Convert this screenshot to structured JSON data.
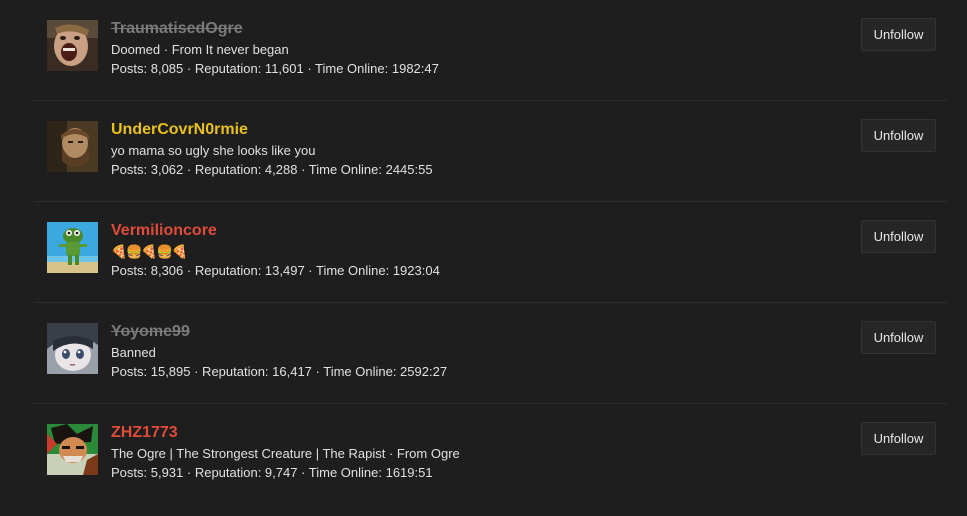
{
  "follow_list": {
    "unfollow_label": "Unfollow",
    "users": [
      {
        "username": "TraumatisedOgre",
        "status": "banned",
        "tagline": "Doomed · From It never began",
        "stats": "Posts: 8,085 · Reputation: 11,601 · Time Online: 1982:47",
        "avatar_icon": "screaming-face-photo"
      },
      {
        "username": "UnderCovrN0rmie",
        "status": "yellow",
        "tagline": "yo mama so ugly she looks like you",
        "stats": "Posts: 3,062 · Reputation: 4,288 · Time Online: 2445:55",
        "avatar_icon": "bearded-man-photo"
      },
      {
        "username": "Vermilioncore",
        "status": "red",
        "tagline": "🍕🍔🍕🍔🍕",
        "stats": "Posts: 8,306 · Reputation: 13,497 · Time Online: 1923:04",
        "avatar_icon": "cartoon-frog-character"
      },
      {
        "username": "Yoyome99",
        "status": "banned",
        "tagline": "Banned",
        "stats": "Posts: 15,895 · Reputation: 16,417 · Time Online: 2592:27",
        "avatar_icon": "anime-girl"
      },
      {
        "username": "ZHZ1773",
        "status": "red",
        "tagline": "The Ogre | The Strongest Creature | The Rapist · From Ogre",
        "stats": "Posts: 5,931 · Reputation: 9,747 · Time Online: 1619:51",
        "avatar_icon": "anime-fighter"
      }
    ]
  }
}
